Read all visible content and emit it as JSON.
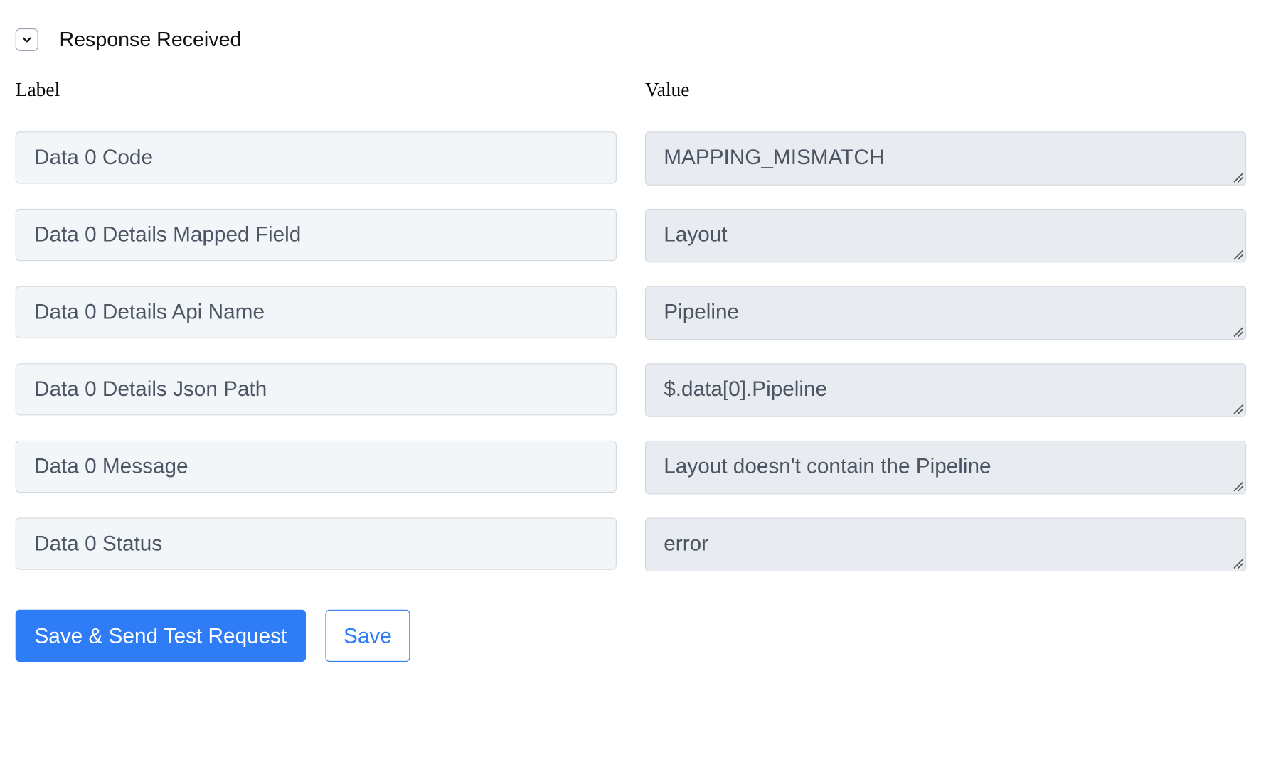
{
  "section": {
    "title": "Response Received",
    "toggle_icon": "chevron-down-icon"
  },
  "columns": {
    "label_header": "Label",
    "value_header": "Value"
  },
  "rows": [
    {
      "label": "Data 0 Code",
      "value": "MAPPING_MISMATCH"
    },
    {
      "label": "Data 0 Details Mapped Field",
      "value": "Layout"
    },
    {
      "label": "Data 0 Details Api Name",
      "value": "Pipeline"
    },
    {
      "label": "Data 0 Details Json Path",
      "value": "$.data[0].Pipeline"
    },
    {
      "label": "Data 0 Message",
      "value": "Layout doesn't contain the Pipeline"
    },
    {
      "label": "Data 0 Status",
      "value": "error"
    }
  ],
  "actions": {
    "primary_label": "Save & Send Test Request",
    "secondary_label": "Save"
  },
  "colors": {
    "accent": "#2f7df6",
    "label_field_bg": "#f3f6f9",
    "value_field_bg": "#e8ebef",
    "border": "#d3d9df"
  }
}
